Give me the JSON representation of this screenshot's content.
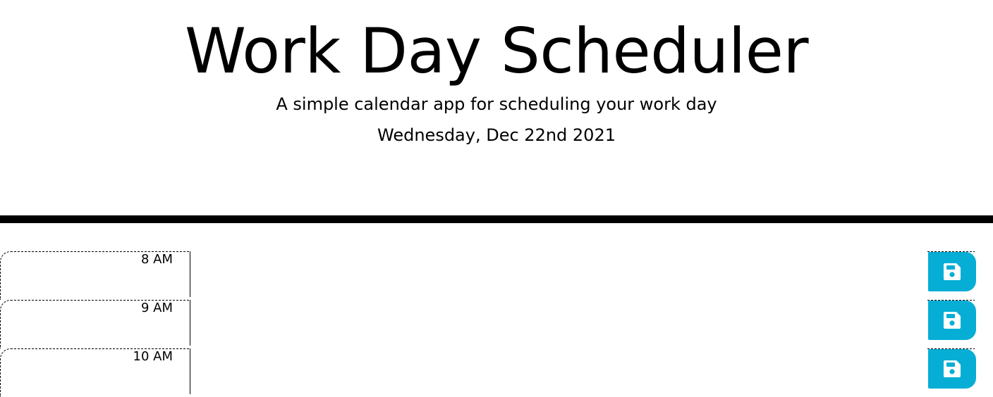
{
  "header": {
    "title": "Work Day Scheduler",
    "subtitle": "A simple calendar app for scheduling your work day",
    "current_day": "Wednesday, Dec 22nd 2021"
  },
  "schedule": {
    "blocks": [
      {
        "hour": "8 AM",
        "description": "",
        "save_icon": "floppy-disk-icon"
      },
      {
        "hour": "9 AM",
        "description": "",
        "save_icon": "floppy-disk-icon"
      },
      {
        "hour": "10 AM",
        "description": "",
        "save_icon": "floppy-disk-icon"
      }
    ]
  },
  "colors": {
    "save_button": "#06aed5",
    "divider": "#000000",
    "background": "#ffffff"
  }
}
